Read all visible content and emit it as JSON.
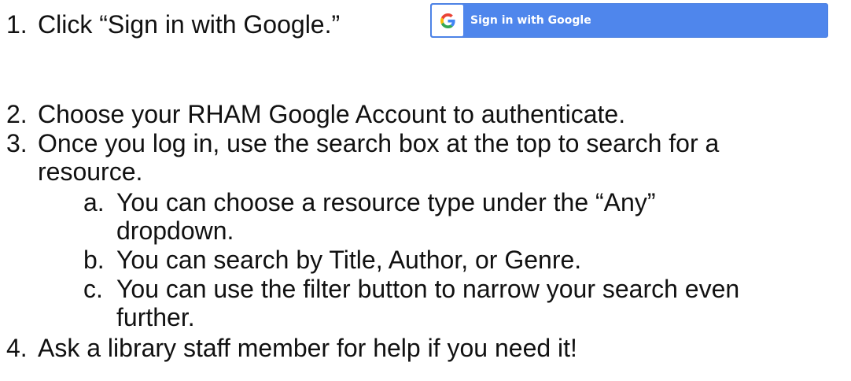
{
  "steps": {
    "s1": {
      "num": "1.",
      "text": "Click “Sign in with Google.”"
    },
    "google_button": {
      "label": "Sign in with Google",
      "icon": "google-g-icon"
    },
    "s2": {
      "num": "2.",
      "text": "Choose your RHAM Google Account to authenticate."
    },
    "s3": {
      "num": "3.",
      "text": "Once you log in, use the search box at the top to search for a",
      "cont": "resource."
    },
    "s3a": {
      "num": "a.",
      "text": "You can choose a resource type under the “Any”",
      "cont": "dropdown."
    },
    "s3b": {
      "num": "b.",
      "text": "You can search by Title, Author, or Genre."
    },
    "s3c": {
      "num": "c.",
      "text": "You can use the filter button to narrow your search even",
      "cont": "further."
    },
    "s4": {
      "num": "4.",
      "text": "Ask a library staff member for help if you need it!"
    }
  },
  "colors": {
    "button_blue": "#4f86ec",
    "text": "#111111"
  }
}
